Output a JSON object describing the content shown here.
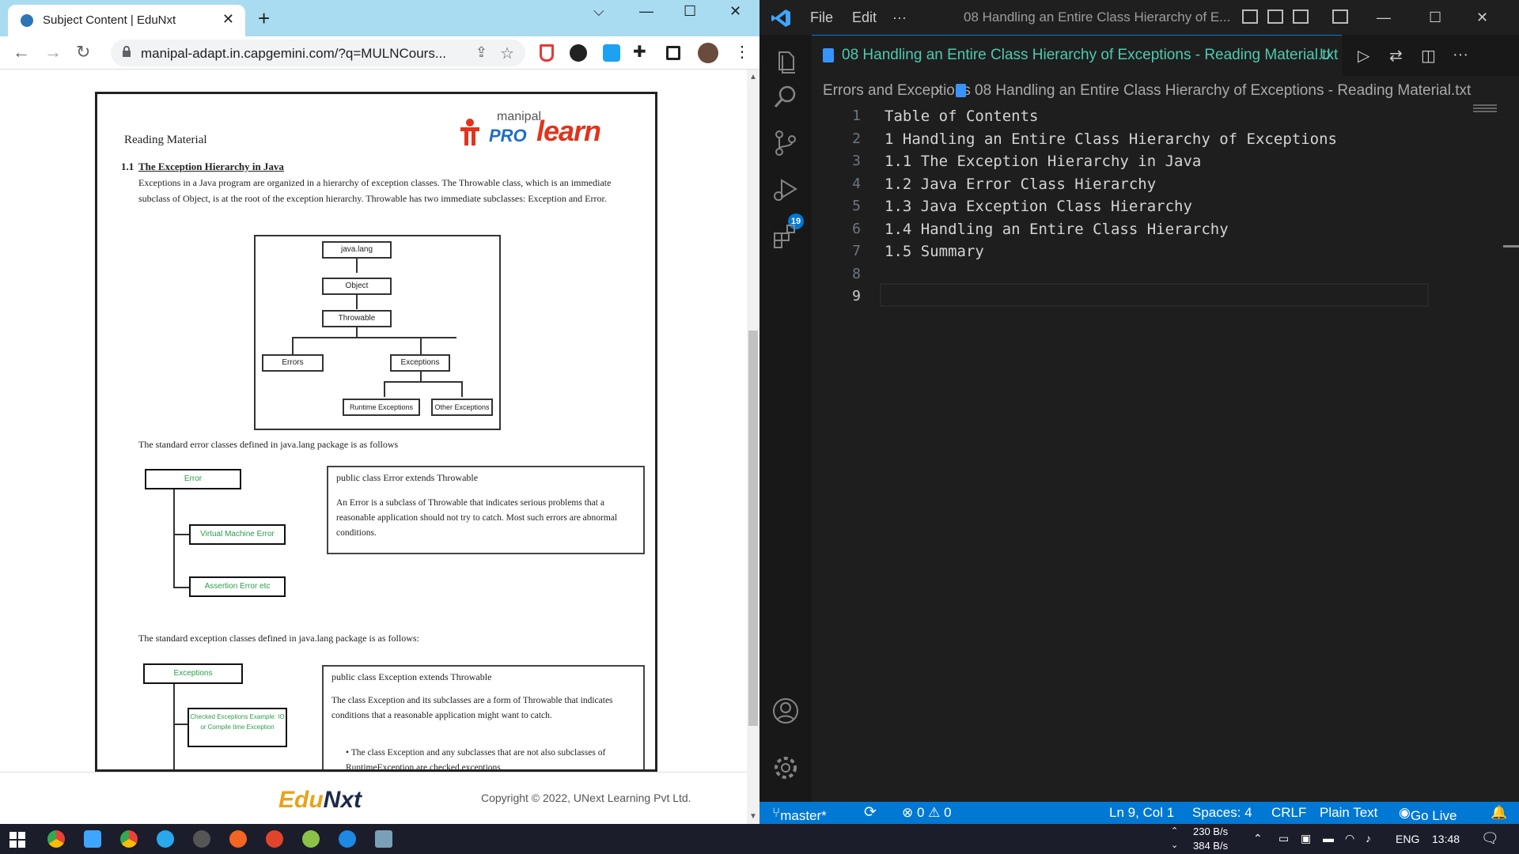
{
  "chrome": {
    "tab_title": "Subject Content | EduNxt",
    "tab_close": "✕",
    "new_tab": "+",
    "url": "manipal-adapt.in.capgemini.com/?q=MULNCours...",
    "window_controls": {
      "chevron": "⌵",
      "minimize": "—",
      "maximize": "☐",
      "close": "✕"
    },
    "nav": {
      "back": "←",
      "forward": "→",
      "reload": "↻"
    }
  },
  "document": {
    "logo": {
      "top": "manipal",
      "pro": "PRO",
      "learn": "learn"
    },
    "reading_material": "Reading Material",
    "section_number": "1.1",
    "section_title": "The Exception Hierarchy in Java",
    "intro_para": "Exceptions in a Java program are organized in a hierarchy of exception classes. The Throwable class, which is an immediate subclass of Object, is at the root of the exception hierarchy. Throwable has two immediate subclasses: Exception and Error.",
    "hierarchy": {
      "java_lang": "java.lang",
      "object": "Object",
      "throwable": "Throwable",
      "errors": "Errors",
      "exceptions": "Exceptions",
      "runtime": "Runtime Exceptions",
      "other": "Other Exceptions"
    },
    "error_intro": "The standard error classes defined in java.lang package is as follows",
    "error_diagram": {
      "root": "Error",
      "child1": "Virtual Machine Error",
      "child2": "Assertion Error etc"
    },
    "error_box": {
      "heading": "public class Error extends Throwable",
      "body": "An Error is a subclass of Throwable that indicates serious problems that a reasonable application should not try to catch. Most such errors are abnormal conditions."
    },
    "exception_intro": "The standard exception classes defined in java.lang package is as follows:",
    "exception_diagram": {
      "root": "Exceptions",
      "child1": "Checked Exceptions Example: IO or Compile time Exception"
    },
    "exception_box": {
      "heading": "public class Exception extends Throwable",
      "body": "The class Exception and its subclasses are a form of Throwable that indicates conditions that a reasonable application might want to catch.",
      "bullet": "The class Exception and any subclasses that are not also subclasses of RuntimeException are checked exceptions."
    },
    "footer": {
      "brand_a": "Edu",
      "brand_b": "Nxt",
      "copyright": "Copyright © 2022, UNext Learning Pvt Ltd."
    }
  },
  "vscode": {
    "menu": {
      "file": "File",
      "edit": "Edit",
      "more": "···"
    },
    "window_title": "08 Handling an Entire Class Hierarchy of E...",
    "tab_name": "08 Handling an Entire Class Hierarchy of Exceptions - Reading Material.txt",
    "tab_modified": "U",
    "breadcrumb_folder": "Errors and Exceptions",
    "breadcrumb_file": "08 Handling an Entire Class Hierarchy of Exceptions - Reading Material.txt",
    "scm_badge": "19",
    "lines": [
      {
        "num": "1",
        "text": "Table of Contents"
      },
      {
        "num": "2",
        "text": "1 Handling an Entire Class Hierarchy of Exceptions"
      },
      {
        "num": "3",
        "text": "1.1 The Exception Hierarchy in Java"
      },
      {
        "num": "4",
        "text": "1.2 Java Error Class Hierarchy"
      },
      {
        "num": "5",
        "text": "1.3 Java Exception Class Hierarchy"
      },
      {
        "num": "6",
        "text": "1.4 Handling an Entire Class Hierarchy"
      },
      {
        "num": "7",
        "text": "1.5 Summary"
      },
      {
        "num": "8",
        "text": ""
      },
      {
        "num": "9",
        "text": ""
      }
    ],
    "status": {
      "branch": "master*",
      "errors": "⊗ 0 ⚠ 0",
      "position": "Ln 9, Col 1",
      "spaces": "Spaces: 4",
      "eol": "CRLF",
      "language": "Plain Text",
      "golive": "Go Live"
    }
  },
  "taskbar": {
    "net_up": "230 B/s",
    "net_down": "384 B/s",
    "lang": "ENG",
    "time": "13:48"
  },
  "colors": {
    "vscode_blue": "#0078d4",
    "chrome_tabstrip": "#a9dcf1",
    "taskbar": "#1b1d2b"
  }
}
